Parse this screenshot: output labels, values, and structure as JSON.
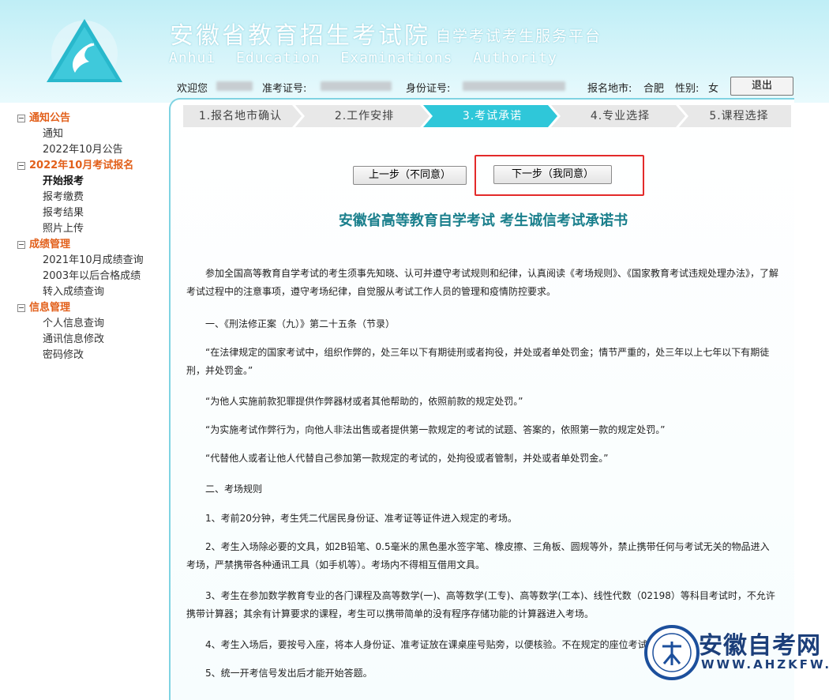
{
  "header": {
    "title": "安徽省教育招生考试院",
    "subtitle": "自学考试考生服务平台",
    "english": "Anhui Education Examinations Authority"
  },
  "userbar": {
    "welcome": "欢迎您",
    "exam_id_label": "准考证号:",
    "id_card_label": "身份证号:",
    "city_label": "报名地市:",
    "city_value": "合肥",
    "gender_label": "性别:",
    "gender_value": "女",
    "logout": "退出"
  },
  "sidebar": {
    "groups": [
      {
        "label": "通知公告",
        "items": [
          "通知",
          "2022年10月公告"
        ]
      },
      {
        "label": "2022年10月考试报名",
        "items": [
          "开始报考",
          "报考缴费",
          "报考结果",
          "照片上传"
        ]
      },
      {
        "label": "成绩管理",
        "items": [
          "2021年10月成绩查询",
          "2003年以后合格成绩",
          "转入成绩查询"
        ]
      },
      {
        "label": "信息管理",
        "items": [
          "个人信息查询",
          "通讯信息修改",
          "密码修改"
        ]
      }
    ]
  },
  "steps": [
    "1.报名地市确认",
    "2.工作安排",
    "3.考试承诺",
    "4.专业选择",
    "5.课程选择"
  ],
  "active_step": 2,
  "buttons": {
    "prev": "上一步（不同意）",
    "next": "下一步（我同意）"
  },
  "document": {
    "title": "安徽省高等教育自学考试 考生诚信考试承诺书",
    "paragraphs": [
      "参加全国高等教育自学考试的考生须事先知晓、认可并遵守考试规则和纪律，认真阅读《考场规则》、《国家教育考试违规处理办法》，了解考试过程中的注意事项，遵守考场纪律，自觉服从考试工作人员的管理和疫情防控要求。",
      "一、《刑法修正案（九）》第二十五条（节录）",
      "“在法律规定的国家考试中，组织作弊的，处三年以下有期徒刑或者拘役，并处或者单处罚金；情节严重的，处三年以上七年以下有期徒刑，并处罚金。”",
      "“为他人实施前款犯罪提供作弊器材或者其他帮助的，依照前款的规定处罚。”",
      "“为实施考试作弊行为，向他人非法出售或者提供第一款规定的考试的试题、答案的，依照第一款的规定处罚。”",
      "“代替他人或者让他人代替自己参加第一款规定的考试的，处拘役或者管制，并处或者单处罚金。”",
      "二、考场规则",
      "1、考前20分钟，考生凭二代居民身份证、准考证等证件进入规定的考场。",
      "2、考生入场除必要的文具，如2B铅笔、0.5毫米的黑色墨水签字笔、橡皮擦、三角板、圆规等外，禁止携带任何与考试无关的物品进入考场，严禁携带各种通讯工具（如手机等）。考场内不得相互借用文具。",
      "3、考生在参加数学教育专业的各门课程及高等数学(一)、高等数学(工专)、高等数学(工本)、线性代数（02198）等科目考试时，不允许携带计算器；其余有计算要求的课程，考生可以携带简单的没有程序存储功能的计算器进入考场。",
      "4、考生入场后，要按号入座，将本人身份证、准考证放在课桌座号贴旁，以便核验。不在规定的座位考试",
      "5、统一开考信号发出后才能开始答题。"
    ]
  },
  "watermark": {
    "text": "安徽自考网",
    "url": "WWW.AHZKFW.COM"
  },
  "colors": {
    "accent": "#1a7f8c",
    "menu_group": "#e2601b",
    "step_active": "#2fc7d9",
    "highlight": "#e32a2a"
  }
}
